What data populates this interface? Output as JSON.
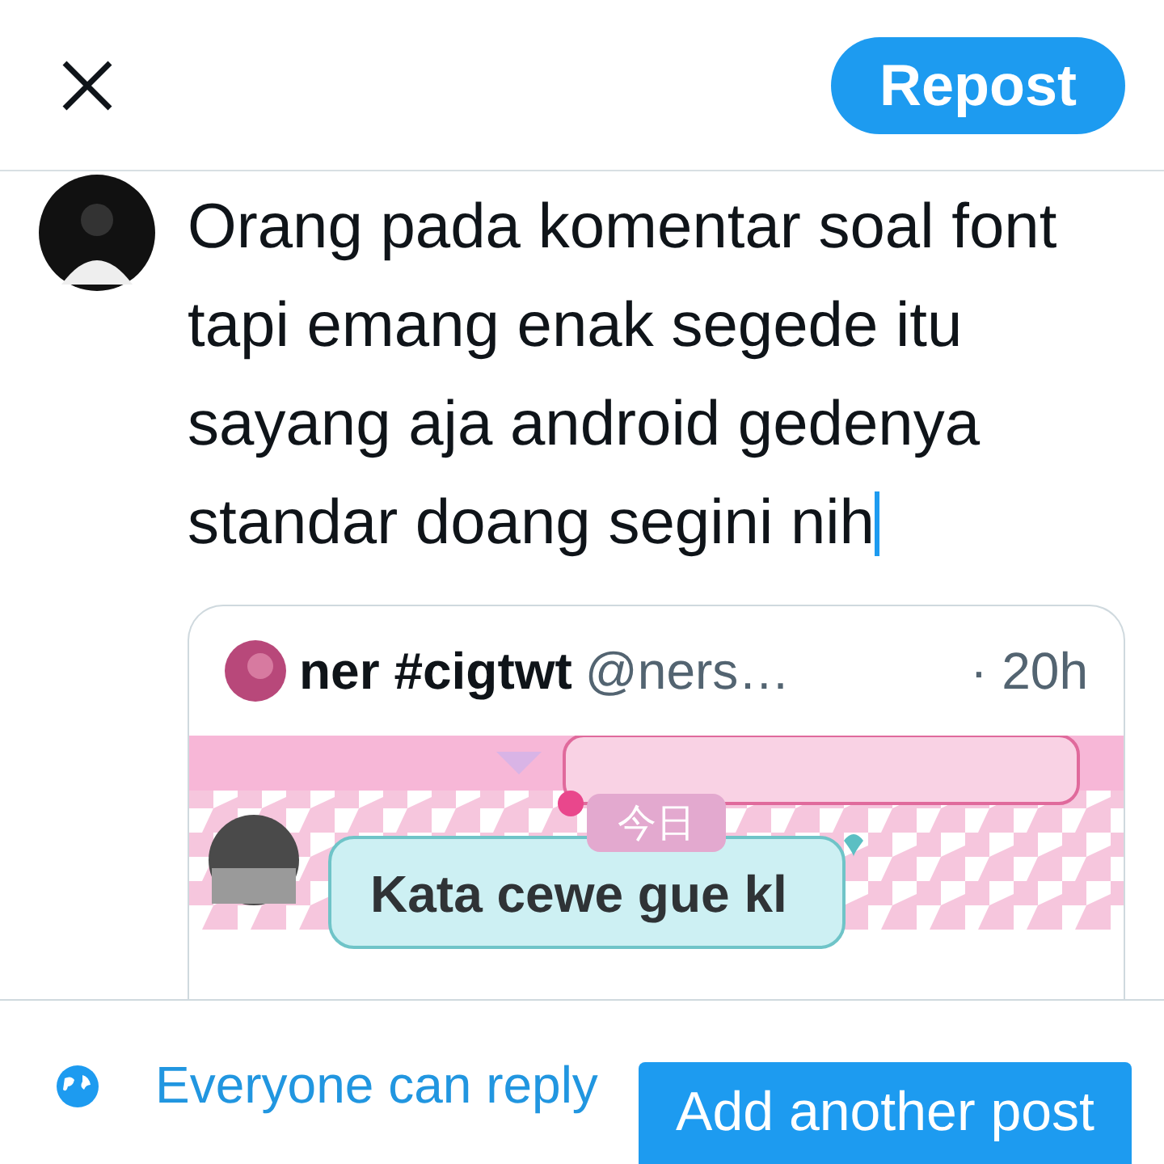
{
  "header": {
    "repost_button": "Repost"
  },
  "composer": {
    "text": "Orang pada komentar soal font tapi emang enak segede itu sayang aja android gedenya standar doang segini nih"
  },
  "quote": {
    "name": "ner #cigtwt",
    "handle": "@ners…",
    "time": "· 20h",
    "screenshot": {
      "date_chip": "今日",
      "message": "Kata cewe gue kl"
    }
  },
  "footer": {
    "reply_setting": "Everyone can reply",
    "add_button": "Add another post"
  }
}
